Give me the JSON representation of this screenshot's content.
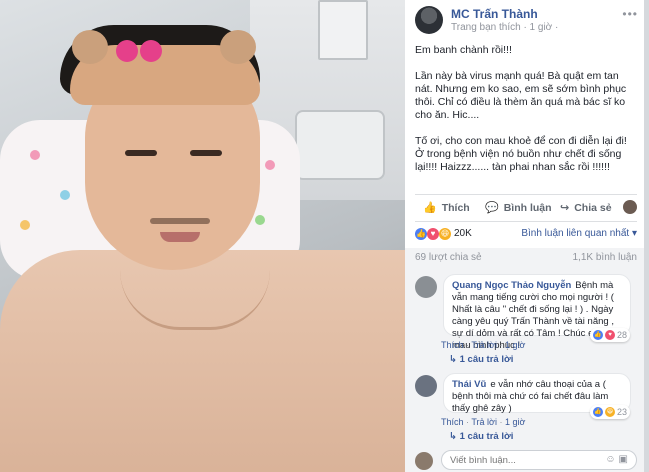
{
  "post": {
    "author": "MC Trấn Thành",
    "meta": "Trang bạn thích · 1 giờ ·",
    "paragraphs": [
      "Em banh chành rồi!!!",
      "Lần này bà virus mạnh quá! Bà quật em tan nát. Nhưng em ko sao, em sẽ sớm bình phục thôi. Chỉ có điều là thèm ăn quá mà bác sĩ ko cho ăn. Hic....",
      "Tố ơi, cho con mau khoẻ để con đi diễn lại đi! Ở trong bệnh viện nó buồn như chết đi sống lại!!!! Haizzz...... tàn phai nhan sắc rồi !!!!!!"
    ],
    "menu_icon": "ellipsis-icon"
  },
  "actions": {
    "like": "Thích",
    "comment": "Bình luận",
    "share": "Chia sẻ"
  },
  "reactions": {
    "count": "20K",
    "sort": "Bình luận liên quan nhất ▾",
    "types": [
      "like",
      "love",
      "haha"
    ],
    "colors": {
      "like": "#4c7ef3",
      "love": "#f0506e",
      "haha": "#f7b125"
    }
  },
  "shares": "69 lượt chia sẻ",
  "comments_count": "1,1K bình luận",
  "comments": [
    {
      "name": "Quang Ngọc Thảo Nguyễn",
      "text": "Bệnh mà vẫn mang tiếng cười cho mọi người ! ( Nhất là câu \" chết đi sống lại ! ) . Ngày càng yêu quý Trấn Thành về tài năng , sự dí dỏm và rất có Tâm ! Chúc em mau bình phục !",
      "reaction_count": "28",
      "links": [
        "Thích",
        "Trả lời",
        "1 giờ"
      ],
      "reply": "1 câu trả lời"
    },
    {
      "name": "Thái Vũ",
      "text": "e vẫn nhớ câu thoại của a ( bệnh thôi mà chứ có fai chết đâu làm thấy ghê zây )",
      "reaction_count": "23",
      "links": [
        "Thích",
        "Trả lời",
        "1 giờ"
      ],
      "reply": "1 câu trả lời"
    }
  ],
  "write": {
    "placeholder": "Viết bình luận..."
  }
}
